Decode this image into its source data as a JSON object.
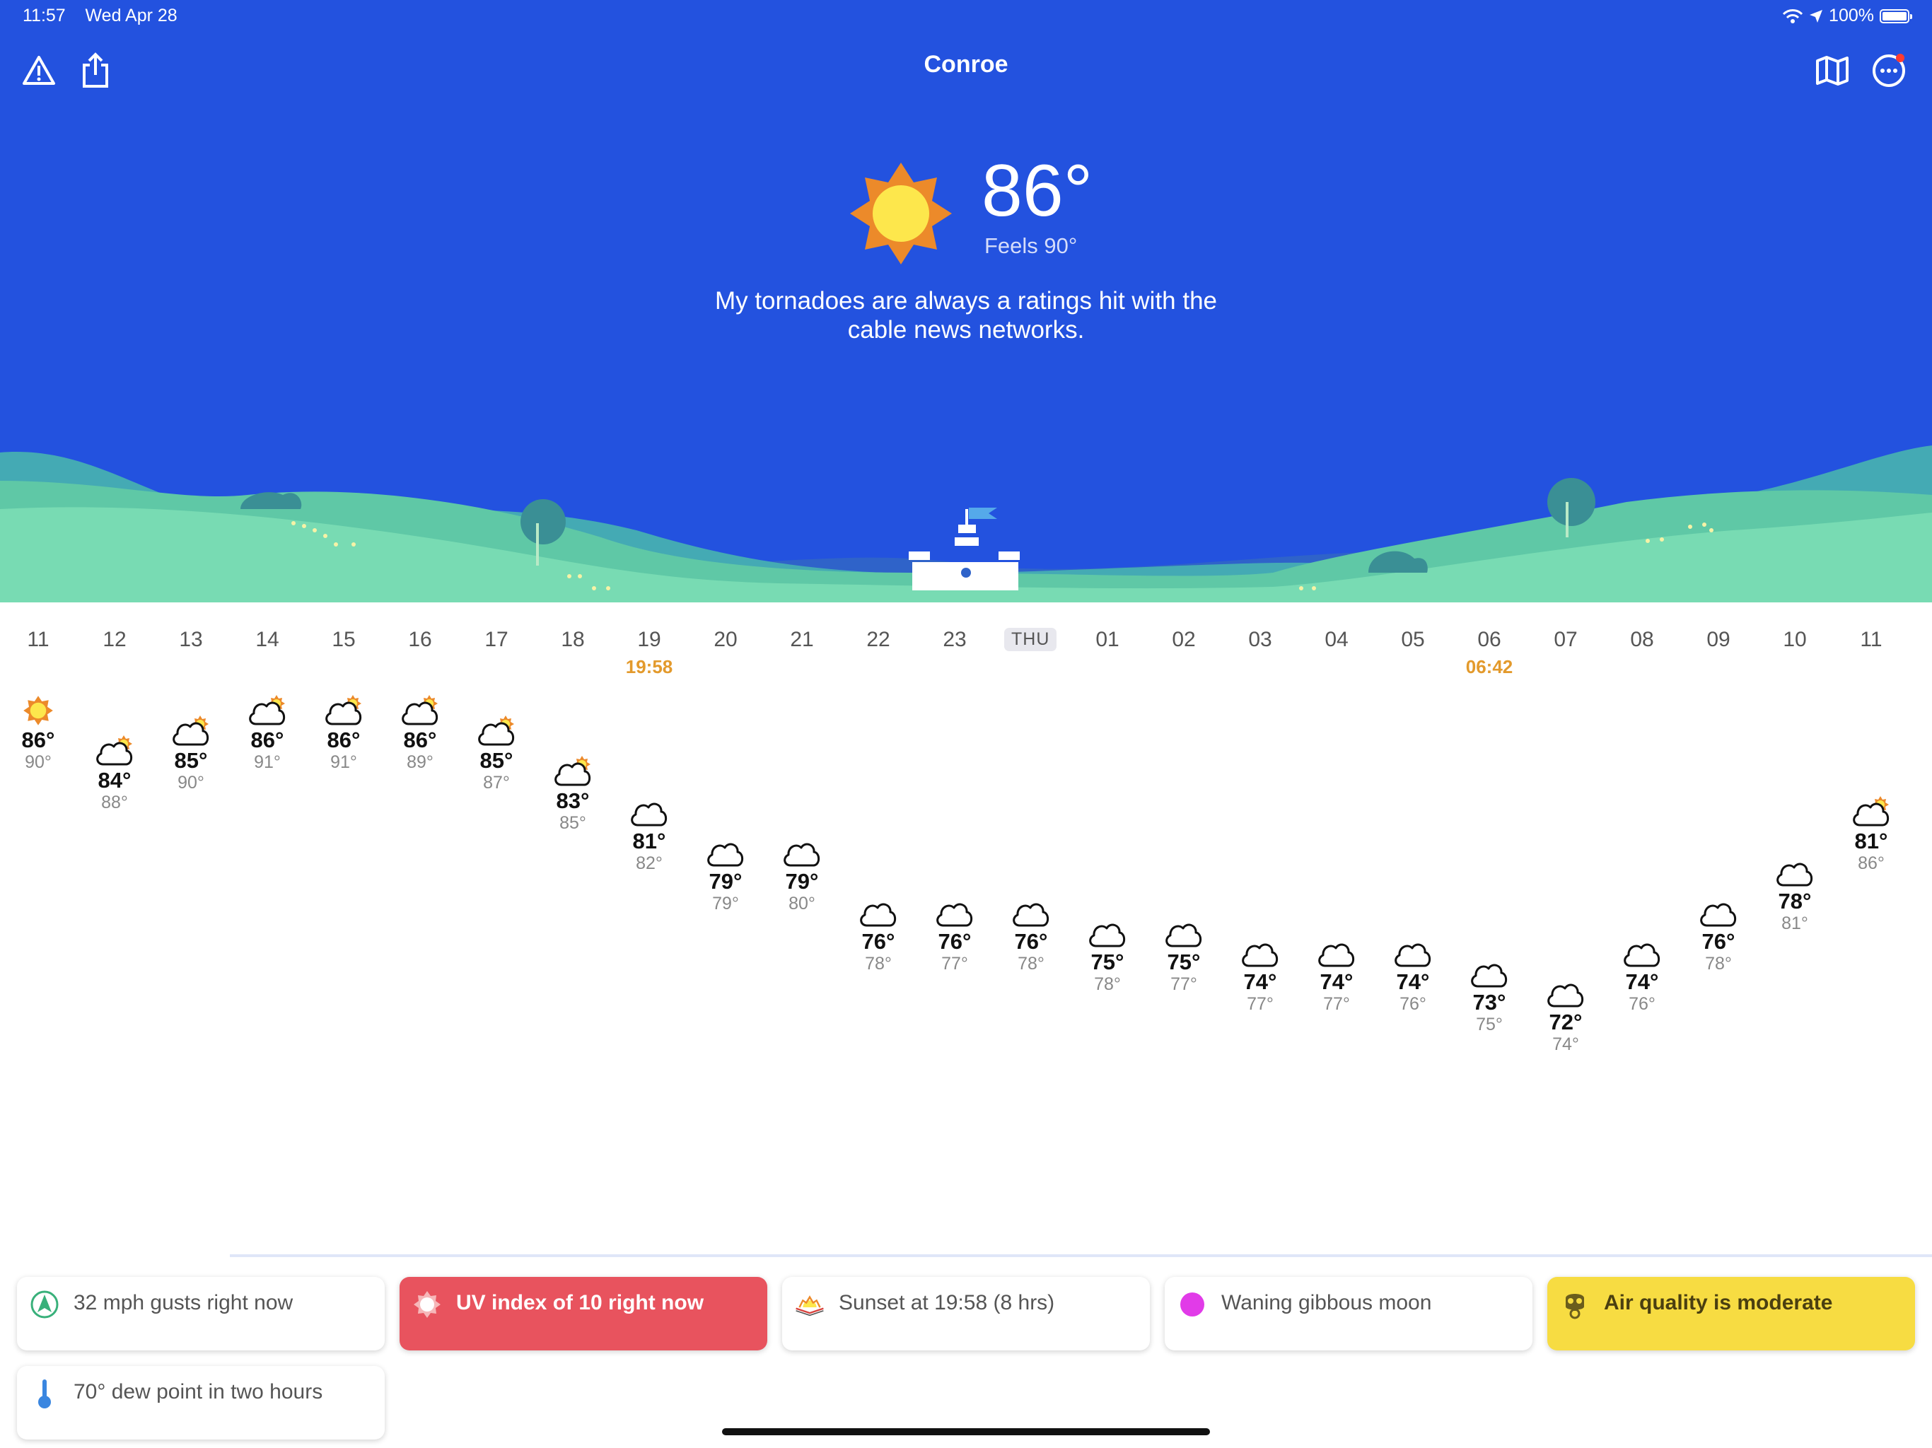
{
  "status_bar": {
    "time": "11:57",
    "date": "Wed Apr 28",
    "battery": "100%"
  },
  "header": {
    "city": "Conroe",
    "left_icons": [
      "alert-triangle-icon",
      "share-icon"
    ],
    "right_icons": [
      "map-icon",
      "more-icon"
    ]
  },
  "current": {
    "temp": "86°",
    "feels": "Feels 90°",
    "quip": "My tornadoes are always a ratings hit with the cable news networks.",
    "condition_icon": "sun-icon"
  },
  "hourly": {
    "day_chip": "THU",
    "hours": [
      {
        "label": "11",
        "temp": "86°",
        "feels": "90°",
        "icon": "sun",
        "value": 86
      },
      {
        "label": "12",
        "temp": "84°",
        "feels": "88°",
        "icon": "partly",
        "value": 84
      },
      {
        "label": "13",
        "temp": "85°",
        "feels": "90°",
        "icon": "partly",
        "value": 85
      },
      {
        "label": "14",
        "temp": "86°",
        "feels": "91°",
        "icon": "partly",
        "value": 86
      },
      {
        "label": "15",
        "temp": "86°",
        "feels": "91°",
        "icon": "partly",
        "value": 86
      },
      {
        "label": "16",
        "temp": "86°",
        "feels": "89°",
        "icon": "partly",
        "value": 86
      },
      {
        "label": "17",
        "temp": "85°",
        "feels": "87°",
        "icon": "partly",
        "value": 85
      },
      {
        "label": "18",
        "temp": "83°",
        "feels": "85°",
        "icon": "partly",
        "value": 83
      },
      {
        "label": "19",
        "temp": "81°",
        "feels": "82°",
        "icon": "cloud",
        "value": 81,
        "mark": "19:58"
      },
      {
        "label": "20",
        "temp": "79°",
        "feels": "79°",
        "icon": "cloud",
        "value": 79
      },
      {
        "label": "21",
        "temp": "79°",
        "feels": "80°",
        "icon": "cloud",
        "value": 79
      },
      {
        "label": "22",
        "temp": "76°",
        "feels": "78°",
        "icon": "cloud",
        "value": 76
      },
      {
        "label": "23",
        "temp": "76°",
        "feels": "77°",
        "icon": "cloud",
        "value": 76
      },
      {
        "label": "THU",
        "temp": "76°",
        "feels": "78°",
        "icon": "cloud",
        "value": 76,
        "chip": true
      },
      {
        "label": "01",
        "temp": "75°",
        "feels": "78°",
        "icon": "cloud",
        "value": 75
      },
      {
        "label": "02",
        "temp": "75°",
        "feels": "77°",
        "icon": "cloud",
        "value": 75
      },
      {
        "label": "03",
        "temp": "74°",
        "feels": "77°",
        "icon": "cloud",
        "value": 74
      },
      {
        "label": "04",
        "temp": "74°",
        "feels": "77°",
        "icon": "cloud",
        "value": 74
      },
      {
        "label": "05",
        "temp": "74°",
        "feels": "76°",
        "icon": "cloud",
        "value": 74
      },
      {
        "label": "06",
        "temp": "73°",
        "feels": "75°",
        "icon": "cloud",
        "value": 73,
        "mark": "06:42"
      },
      {
        "label": "07",
        "temp": "72°",
        "feels": "74°",
        "icon": "cloud",
        "value": 72
      },
      {
        "label": "08",
        "temp": "74°",
        "feels": "76°",
        "icon": "cloud",
        "value": 74
      },
      {
        "label": "09",
        "temp": "76°",
        "feels": "78°",
        "icon": "cloud",
        "value": 76
      },
      {
        "label": "10",
        "temp": "78°",
        "feels": "81°",
        "icon": "cloud",
        "value": 78
      },
      {
        "label": "11",
        "temp": "81°",
        "feels": "86°",
        "icon": "partly",
        "value": 81
      }
    ]
  },
  "cards": [
    {
      "id": "gusts",
      "text": "32 mph gusts right now",
      "icon": "wind-direction-icon"
    },
    {
      "id": "uv",
      "text": "UV index of 10 right now",
      "icon": "uv-sun-icon"
    },
    {
      "id": "sunset",
      "text": "Sunset at 19:58 (8 hrs)",
      "icon": "sunset-icon"
    },
    {
      "id": "moon",
      "text": "Waning gibbous moon",
      "icon": "moon-icon"
    },
    {
      "id": "air",
      "text": "Air quality is moderate",
      "icon": "gas-mask-icon"
    },
    {
      "id": "dew",
      "text": "70° dew point in two hours",
      "icon": "thermometer-icon"
    }
  ],
  "colors": {
    "sky": "#2352df",
    "uv_card": "#e8535e",
    "air_card": "#f7dc42",
    "time_mark": "#e39a2c"
  }
}
